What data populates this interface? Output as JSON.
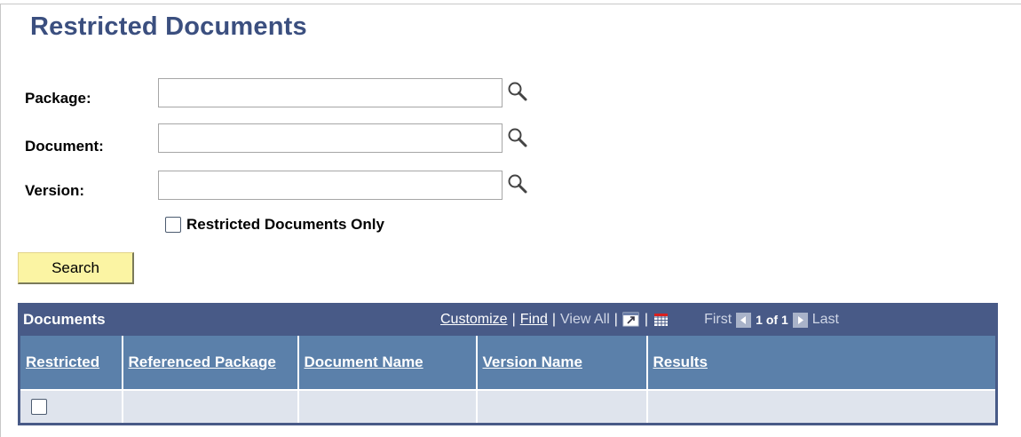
{
  "page": {
    "title": "Restricted Documents"
  },
  "form": {
    "package": {
      "label": "Package:",
      "value": ""
    },
    "document": {
      "label": "Document:",
      "value": ""
    },
    "version": {
      "label": "Version:",
      "value": ""
    },
    "restricted_only": {
      "label": "Restricted Documents Only",
      "checked": false
    },
    "lookup_icon": "magnifier-lookup-icon",
    "search_label": "Search"
  },
  "grid": {
    "title": "Documents",
    "toolbar": {
      "customize": "Customize",
      "find": "Find",
      "view_all": "View All",
      "zoom_icon": "new-window-icon",
      "download_icon": "spreadsheet-download-icon",
      "first": "First",
      "range": "1 of 1",
      "last": "Last"
    },
    "columns": [
      "Restricted",
      "Referenced Package",
      "Document Name",
      "Version Name",
      "Results"
    ],
    "rows": [
      {
        "restricted": false,
        "referenced_package": "",
        "document_name": "",
        "version_name": "",
        "results": ""
      }
    ]
  },
  "colors": {
    "title": "#3b4f7f",
    "grid_header_bg": "#485a87",
    "column_header_bg": "#5b80aa",
    "row_bg": "#dfe4ed",
    "search_button_bg": "#fbf4a3"
  }
}
